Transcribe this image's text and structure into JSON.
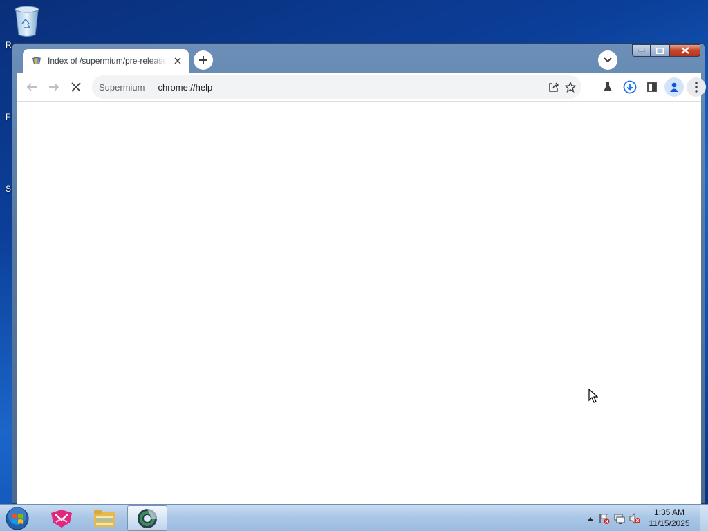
{
  "desktop": {
    "icons": [
      {
        "name": "Recycle Bin",
        "icon": "recycle-bin-icon"
      }
    ],
    "edge_fragments": [
      "R",
      "F",
      "S"
    ]
  },
  "browser": {
    "app_name": "Supermium",
    "tab": {
      "title": "Index of /supermium/pre-release",
      "favicon": "supermium-favicon"
    },
    "toolbar": {
      "back_icon": "back-arrow-icon",
      "forward_icon": "forward-arrow-icon",
      "stop_icon": "stop-loading-icon",
      "omnibox_chip": "Supermium",
      "url": "chrome://help"
    },
    "toolbar_icons": [
      "share-icon",
      "bookmark-star-icon",
      "labs-flask-icon",
      "download-icon",
      "side-panel-icon",
      "profile-icon",
      "menu-kebab-icon"
    ],
    "accent_color": "#1a73e8"
  },
  "taskbar": {
    "apps": [
      "start-orb",
      "vpn-app-icon",
      "file-explorer-icon",
      "supermium-browser-icon"
    ],
    "tray_icons": [
      "show-hidden-icons-arrow",
      "action-center-flag-icon",
      "network-icon",
      "volume-muted-icon"
    ],
    "clock": {
      "time": "1:35 AM",
      "date": "11/15/2025"
    }
  }
}
